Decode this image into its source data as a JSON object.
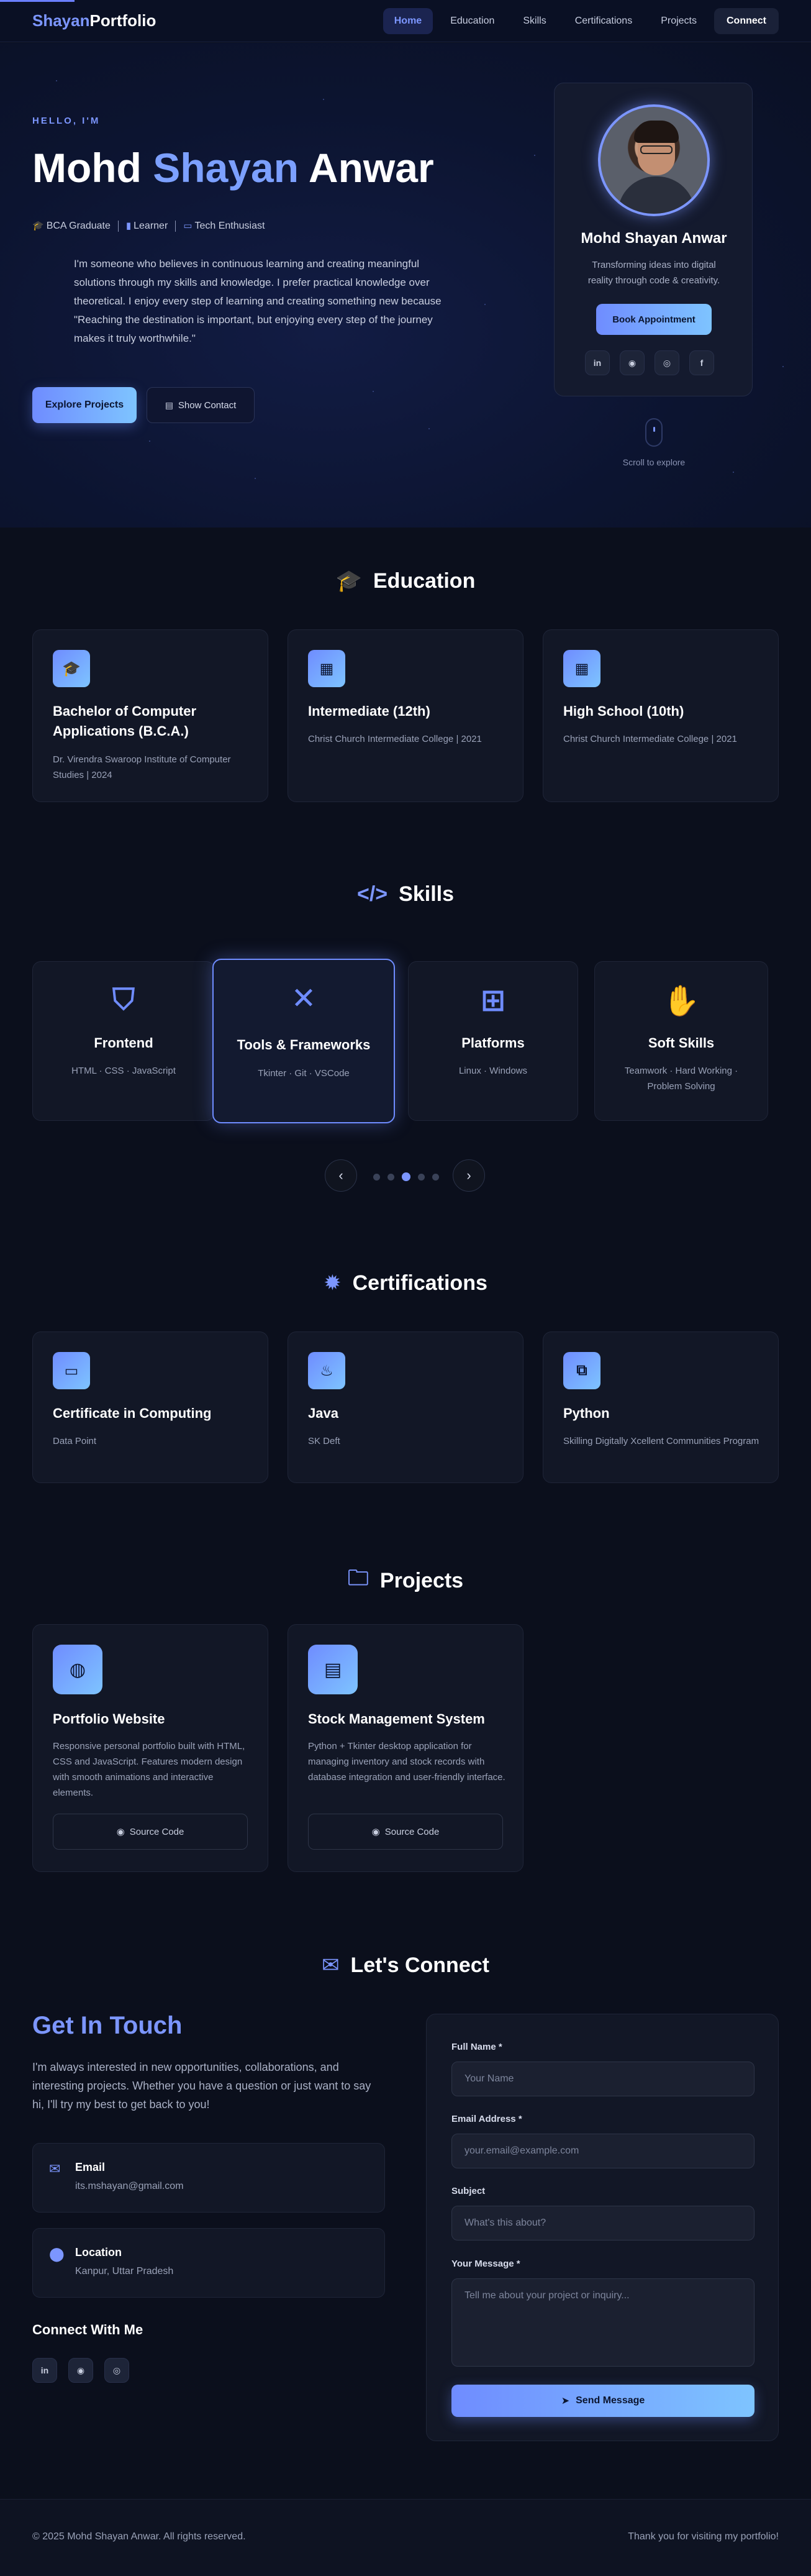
{
  "nav": {
    "brand_accent": "Shayan",
    "brand_rest": "Portfolio",
    "links": [
      "Home",
      "Education",
      "Skills",
      "Certifications",
      "Projects"
    ],
    "active": "Home",
    "connect_label": "Connect"
  },
  "hero": {
    "eyebrow": "HELLO, I'M",
    "name_first": "Mohd ",
    "name_mid": "Shayan",
    "name_last": " Anwar",
    "tags": [
      "BCA Graduate",
      "Learner",
      "Tech Enthusiast"
    ],
    "bio": "I'm someone who believes in continuous learning and creating meaningful solutions through my skills and knowledge. I prefer practical knowledge over theoretical. I enjoy every step of learning and creating something new because \"Reaching the destination is important, but enjoying every step of the journey makes it truly worthwhile.\"",
    "primary_cta": "Explore Projects",
    "secondary_cta": "Show Contact",
    "scroll_hint": "Scroll to explore"
  },
  "profile": {
    "name": "Mohd Shayan Anwar",
    "tagline": "Transforming ideas into digital reality through code & creativity.",
    "cta": "Book Appointment",
    "socials": [
      "linkedin-icon",
      "github-icon",
      "instagram-icon",
      "facebook-icon"
    ]
  },
  "education": {
    "title": "Education",
    "items": [
      {
        "icon": "graduation-cap-icon",
        "title": "Bachelor of Computer Applications (B.C.A.)",
        "sub": "Dr. Virendra Swaroop Institute of Computer Studies | 2024"
      },
      {
        "icon": "school-icon",
        "title": "Intermediate (12th)",
        "sub": "Christ Church Intermediate College | 2021"
      },
      {
        "icon": "school-icon",
        "title": "High School (10th)",
        "sub": "Christ Church Intermediate College | 2021"
      }
    ]
  },
  "skills": {
    "title": "Skills",
    "items": [
      {
        "icon": "html5-icon",
        "title": "Frontend",
        "list": "HTML · CSS · JavaScript"
      },
      {
        "icon": "tools-icon",
        "title": "Tools & Frameworks",
        "list": "Tkinter · Git · VSCode"
      },
      {
        "icon": "network-icon",
        "title": "Platforms",
        "list": "Linux · Windows"
      },
      {
        "icon": "handshake-icon",
        "title": "Soft Skills",
        "list": "Teamwork · Hard Working · Problem Solving"
      }
    ],
    "active_dot": 2,
    "dot_count": 5
  },
  "certifications": {
    "title": "Certifications",
    "items": [
      {
        "icon": "laptop-icon",
        "title": "Certificate in Computing",
        "sub": "Data Point"
      },
      {
        "icon": "java-icon",
        "title": "Java",
        "sub": "SK Deft"
      },
      {
        "icon": "python-icon",
        "title": "Python",
        "sub": "Skilling Digitally Xcellent Communities Program"
      }
    ]
  },
  "projects": {
    "title": "Projects",
    "items": [
      {
        "icon": "globe-icon",
        "title": "Portfolio Website",
        "desc": "Responsive personal portfolio built with HTML, CSS and JavaScript. Features modern design with smooth animations and interactive elements.",
        "button": "Source Code"
      },
      {
        "icon": "warehouse-icon",
        "title": "Stock Management System",
        "desc": "Python + Tkinter desktop application for managing inventory and stock records with database integration and user-friendly interface.",
        "button": "Source Code"
      }
    ]
  },
  "contact": {
    "title": "Let's Connect",
    "heading": "Get In Touch",
    "text": "I'm always interested in new opportunities, collaborations, and interesting projects. Whether you have a question or just want to say hi, I'll try my best to get back to you!",
    "email_label": "Email",
    "email_value": "its.mshayan@gmail.com",
    "location_label": "Location",
    "location_value": "Kanpur, Uttar Pradesh",
    "connect_with_me": "Connect With Me",
    "form": {
      "name_label": "Full Name *",
      "name_placeholder": "Your Name",
      "email_label": "Email Address *",
      "email_placeholder": "your.email@example.com",
      "subject_label": "Subject",
      "subject_placeholder": "What's this about?",
      "message_label": "Your Message *",
      "message_placeholder": "Tell me about your project or inquiry...",
      "submit": "Send Message"
    }
  },
  "footer": {
    "copyright": "© 2025 Mohd Shayan Anwar. All rights reserved.",
    "thanks": "Thank you for visiting my portfolio!"
  },
  "colors": {
    "accent": "#7c96ff",
    "background": "#0b0f1c",
    "card": "#121726"
  }
}
